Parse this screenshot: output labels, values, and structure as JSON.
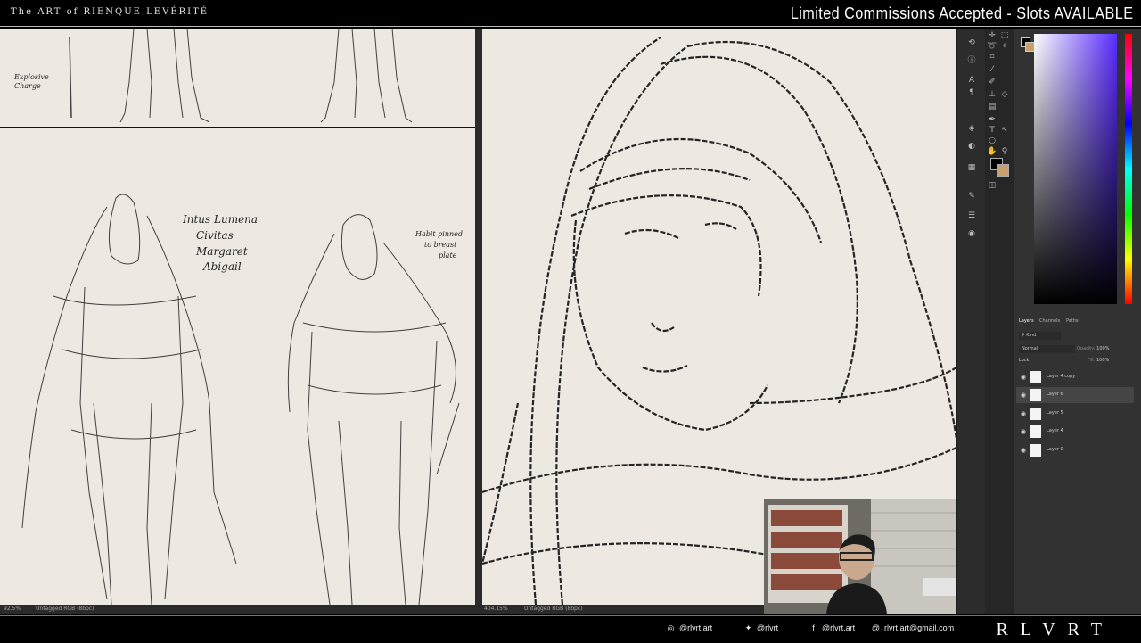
{
  "header": {
    "brand": "The ART of RIENQUE LEVÉRITÉ",
    "promo": "Limited Commissions Accepted - Slots AVAILABLE"
  },
  "left_canvas": {
    "notes": {
      "explosive_charge": "Explosive Charge",
      "names": [
        "Intus Lumena",
        "Civitas",
        "Margaret",
        "Abigail"
      ],
      "habit_note": [
        "Habit pinned",
        "to breast",
        "plate"
      ]
    },
    "status": {
      "zoom": "92.5%",
      "doc": "Untagged RGB (8bpc)"
    }
  },
  "right_canvas": {
    "status": {
      "zoom": "404.15%",
      "doc": "Untagged RGB (8bpc)"
    }
  },
  "layers_panel": {
    "tabs": [
      "Layers",
      "Channels",
      "Paths"
    ],
    "filter": "Kind",
    "blend_mode": "Normal",
    "opacity_label": "Opacity:",
    "opacity": "100%",
    "lock_label": "Lock:",
    "fill_label": "Fill:",
    "fill": "100%",
    "layers": [
      {
        "name": "Layer 4 copy",
        "selected": false
      },
      {
        "name": "Layer 6",
        "selected": true
      },
      {
        "name": "Layer 5",
        "selected": false
      },
      {
        "name": "Layer 4",
        "selected": false
      },
      {
        "name": "Layer 0",
        "selected": false
      }
    ]
  },
  "footer": {
    "instagram": "@rlvrt.art",
    "twitter": "@rlvrt",
    "facebook": "@rlvrt.art",
    "email": "rlvrt.art@gmail.com",
    "logo": "RLVRT"
  },
  "colors": {
    "canvas": "#eee8e2",
    "ps_panel": "#323232",
    "hue_accent": "#5a2cff"
  }
}
